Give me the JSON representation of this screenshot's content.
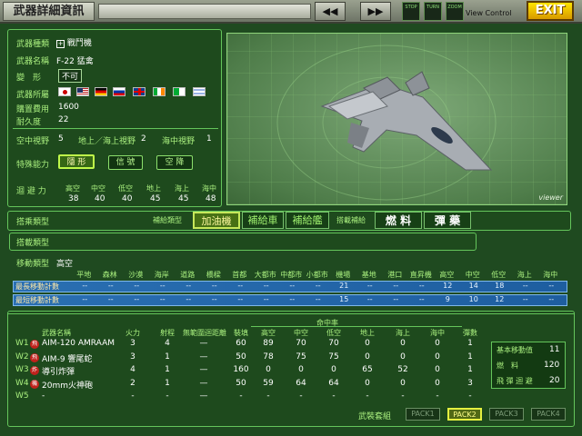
{
  "topbar": {
    "title": "武器詳細資訊",
    "prev_label": "◀◀",
    "next_label": "▶▶",
    "stop_label": "STOP",
    "turn_label": "TURN",
    "zoom_label": "ZOOM",
    "view_control": "View Control",
    "exit_label": "EXIT"
  },
  "info": {
    "type_label": "武器種類",
    "type_value": "戰鬥機",
    "name_label": "武器名稱",
    "name_value": "F-22 猛禽",
    "transform_label": "變　形",
    "transform_value": "不可",
    "owner_label": "武器所屬",
    "cost_label": "購置費用",
    "cost_value": "1600",
    "durability_label": "耐久度",
    "durability_value": "22",
    "air_view_label": "空中視野",
    "air_view_value": "5",
    "land_view_label": "地上／海上視野",
    "land_view_value": "2",
    "sea_view_label": "海中視野",
    "sea_view_value": "1",
    "ability_label": "特殊能力",
    "abilities": [
      "隱 形",
      "信 號",
      "空 降"
    ],
    "evade_label": "迴 避 力",
    "evade_headers": [
      "高空",
      "中空",
      "低空",
      "地上",
      "海上",
      "海中"
    ],
    "evade_values": [
      "38",
      "40",
      "40",
      "45",
      "45",
      "48"
    ]
  },
  "viewer_label": "viewer",
  "tabs": {
    "carrier_label": "搭乘類型",
    "supply_type_label": "補給類型",
    "supply_items": [
      "加油機",
      "補給車",
      "補給艦"
    ],
    "cargo_supply_label": "搭載補給",
    "cargo_items": [
      "燃 料",
      "彈 藥"
    ],
    "load_type_label": "搭載類型",
    "move_type_label": "移動類型",
    "move_type_value": "高空"
  },
  "movement": {
    "headers": [
      "平地",
      "森林",
      "沙漠",
      "海岸",
      "道路",
      "橋樑",
      "首都",
      "大都市",
      "中都市",
      "小都市",
      "機場",
      "基地",
      "港口",
      "直昇機場",
      "高空",
      "中空",
      "低空",
      "海上",
      "海中"
    ],
    "rows": [
      {
        "label": "最長移動計數",
        "values": [
          "--",
          "--",
          "--",
          "--",
          "--",
          "--",
          "--",
          "--",
          "--",
          "--",
          "21",
          "--",
          "--",
          "--",
          "12",
          "14",
          "18",
          "--",
          "--"
        ]
      },
      {
        "label": "最短移動計數",
        "values": [
          "--",
          "--",
          "--",
          "--",
          "--",
          "--",
          "--",
          "--",
          "--",
          "--",
          "15",
          "--",
          "--",
          "--",
          "9",
          "10",
          "12",
          "--",
          "--"
        ]
      }
    ]
  },
  "weapons": {
    "hit_rate_label": "命中率",
    "headers": [
      "武器名稱",
      "火力",
      "射程",
      "無範圍迴距離",
      "裝填",
      "高空",
      "中空",
      "低空",
      "地上",
      "海上",
      "海中",
      "彈數"
    ],
    "rows": [
      {
        "slot": "W1",
        "badge": "飛",
        "name": "AIM-120 AMRAAM",
        "power": "3",
        "range": "4",
        "min": "—",
        "reload": "60",
        "hi": "89",
        "mid": "70",
        "low": "70",
        "land": "0",
        "sea": "0",
        "under": "0",
        "ammo": "1"
      },
      {
        "slot": "W2",
        "badge": "飛",
        "name": "AIM-9 響尾蛇",
        "power": "3",
        "range": "1",
        "min": "—",
        "reload": "50",
        "hi": "78",
        "mid": "75",
        "low": "75",
        "land": "0",
        "sea": "0",
        "under": "0",
        "ammo": "1"
      },
      {
        "slot": "W3",
        "badge": "炸",
        "name": "導引炸彈",
        "power": "4",
        "range": "1",
        "min": "—",
        "reload": "160",
        "hi": "0",
        "mid": "0",
        "low": "0",
        "land": "65",
        "sea": "52",
        "under": "0",
        "ammo": "1"
      },
      {
        "slot": "W4",
        "badge": "機",
        "name": "20mm火神砲",
        "power": "2",
        "range": "1",
        "min": "—",
        "reload": "50",
        "hi": "59",
        "mid": "64",
        "low": "64",
        "land": "0",
        "sea": "0",
        "under": "0",
        "ammo": "3"
      },
      {
        "slot": "W5",
        "badge": "",
        "name": "-",
        "power": "-",
        "range": "-",
        "min": "—",
        "reload": "-",
        "hi": "-",
        "mid": "-",
        "low": "-",
        "land": "-",
        "sea": "-",
        "under": "-",
        "ammo": "-"
      }
    ],
    "side": [
      {
        "label": "基本移動值",
        "value": "11"
      },
      {
        "label": "燃　料",
        "value": "120"
      },
      {
        "label": "飛 彈 迴 避",
        "value": "20"
      }
    ],
    "pack_label": "武裝套組",
    "packs": [
      "PACK1",
      "PACK2",
      "PACK3",
      "PACK4"
    ],
    "active_pack_index": 1
  },
  "colors": {
    "accent": "#a9ef7e",
    "active_highlight": "#bff84a",
    "exit": "#ffd400",
    "movement_row": "#2a6fb2"
  }
}
